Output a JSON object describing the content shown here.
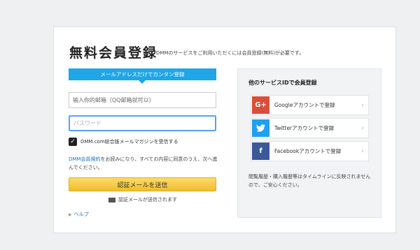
{
  "page": {
    "title": "無料会員登録",
    "subtitle": "DMMのサービスをご利用いただくには会員登録(無料)が必要です。"
  },
  "form": {
    "banner": "メールアドレスだけでカンタン登録",
    "email_placeholder": "输入你的邮箱（QQ邮箱就可以）",
    "password_placeholder": "パスワード",
    "newsletter_label": "DMM.com総合版メールマガジンを受信する",
    "newsletter_checked": true,
    "terms_link": "DMM会員規約",
    "terms_text": "をお読みになり、すべての内容に同意のうえ、次へ進んでください。",
    "submit_label": "認証メールを送信",
    "notice": "認証メールが送信されます",
    "help": "ヘルプ"
  },
  "other_services": {
    "title": "他のサービスIDで会員登録",
    "items": [
      {
        "icon": "google-plus-icon",
        "glyph": "G+",
        "label": "Googleアカウントで登録",
        "color": "#dd4b39"
      },
      {
        "icon": "twitter-icon",
        "glyph": "🐦",
        "label": "Twitterアカウントで登録",
        "color": "#1da1f2"
      },
      {
        "icon": "facebook-icon",
        "glyph": "f",
        "label": "Facebookアカウントで登録",
        "color": "#3b5998"
      }
    ],
    "note": "閲覧履歴・購入履歴等はタイムラインに反映されませんので、ご安心ください。"
  }
}
